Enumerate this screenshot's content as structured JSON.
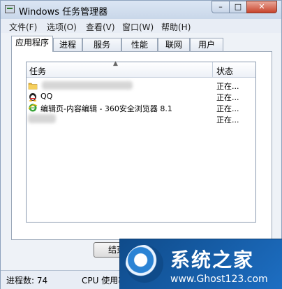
{
  "window": {
    "title": "Windows 任务管理器",
    "controls": {
      "minimize": "–",
      "maximize": "□",
      "close": "✕"
    }
  },
  "menu": [
    "文件(F)",
    "选项(O)",
    "查看(V)",
    "窗口(W)",
    "帮助(H)"
  ],
  "tabs": [
    "应用程序",
    "进程",
    "服务",
    "性能",
    "联网",
    "用户"
  ],
  "active_tab": "应用程序",
  "list": {
    "columns": {
      "task": "任务",
      "status": "状态"
    },
    "rows": [
      {
        "name": "",
        "status": "正在...",
        "icon": "folder-icon"
      },
      {
        "name": "QQ",
        "status": "正在...",
        "icon": "qq-penguin-icon"
      },
      {
        "name": "编辑页-内容编辑 - 360安全浏览器 8.1",
        "status": "正在...",
        "icon": "ie-browser-icon"
      },
      {
        "name": "",
        "status": "正在...",
        "icon": "blurred-icon"
      }
    ]
  },
  "buttons": {
    "end_task": "结束任"
  },
  "statusbar": {
    "processes": "进程数: 74",
    "cpu": "CPU 使用率"
  },
  "watermark": {
    "title": "系统之家",
    "url": "www.Ghost123.com"
  },
  "colors": {
    "title_bg": "#c9d7e9",
    "close_btn": "#c8442c",
    "watermark_bg": "#1d6ec2"
  }
}
